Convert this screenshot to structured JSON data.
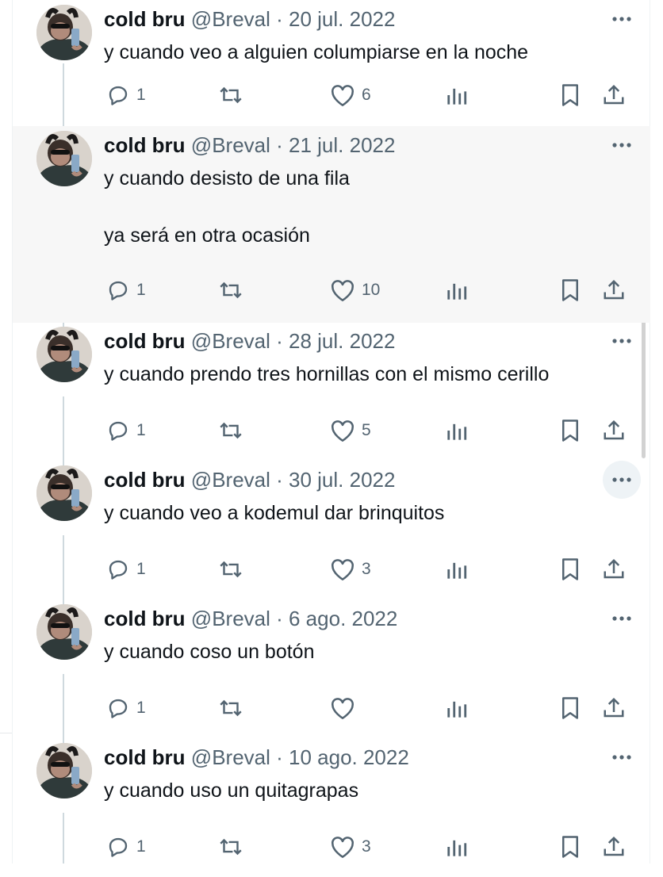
{
  "tweets": [
    {
      "name": "cold bru",
      "handle": "@Breval",
      "sep": " · ",
      "date": "20 jul. 2022",
      "text": "y cuando veo a alguien columpiarse en la noche",
      "replies": "1",
      "retweets": "",
      "likes": "6"
    },
    {
      "name": "cold bru",
      "handle": "@Breval",
      "sep": " · ",
      "date": "21 jul. 2022",
      "text": "y cuando desisto de una fila\n\nya será en otra ocasión",
      "replies": "1",
      "retweets": "",
      "likes": "10"
    },
    {
      "name": "cold bru",
      "handle": "@Breval",
      "sep": " · ",
      "date": "28 jul. 2022",
      "text": "y cuando prendo tres hornillas con el mismo cerillo",
      "replies": "1",
      "retweets": "",
      "likes": "5"
    },
    {
      "name": "cold bru",
      "handle": "@Breval",
      "sep": " · ",
      "date": "30 jul. 2022",
      "text": "y cuando veo a kodemul dar brinquitos",
      "replies": "1",
      "retweets": "",
      "likes": "3"
    },
    {
      "name": "cold bru",
      "handle": "@Breval",
      "sep": " · ",
      "date": "6 ago. 2022",
      "text": "y cuando coso un botón",
      "replies": "1",
      "retweets": "",
      "likes": ""
    },
    {
      "name": "cold bru",
      "handle": "@Breval",
      "sep": " · ",
      "date": "10 ago. 2022",
      "text": "y cuando uso un quitagrapas",
      "replies": "1",
      "retweets": "",
      "likes": "3"
    }
  ],
  "icons": {
    "more": "more-icon",
    "reply": "reply-icon",
    "retweet": "retweet-icon",
    "like": "heart-icon",
    "views": "views-icon",
    "bookmark": "bookmark-icon",
    "share": "share-icon"
  },
  "colors": {
    "text": "#0f1419",
    "secondary": "#536471",
    "thread_line": "#cfd9de",
    "highlight_bg": "#f7f7f7"
  }
}
